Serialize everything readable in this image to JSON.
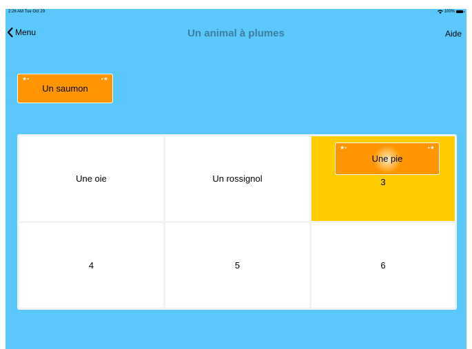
{
  "status_bar": {
    "time": "2:26 AM  Tue Oct 29",
    "battery": "100%"
  },
  "nav": {
    "back_label": "Menu",
    "title": "Un animal à plumes",
    "help_label": "Aide"
  },
  "source_card": {
    "label": "Un saumon"
  },
  "placed_card": {
    "label": "Une pie"
  },
  "grid": {
    "cells": [
      "Une oie",
      "Un rossignol",
      "3",
      "4",
      "5",
      "6"
    ]
  },
  "colors": {
    "background": "#5ac8fa",
    "card": "#ff9500",
    "highlight": "#ffcc00",
    "title": "#3a7f9e"
  },
  "icons": {
    "back": "chevron-left-icon",
    "wifi": "wifi-icon",
    "battery": "battery-icon",
    "stars": "star-icon"
  }
}
